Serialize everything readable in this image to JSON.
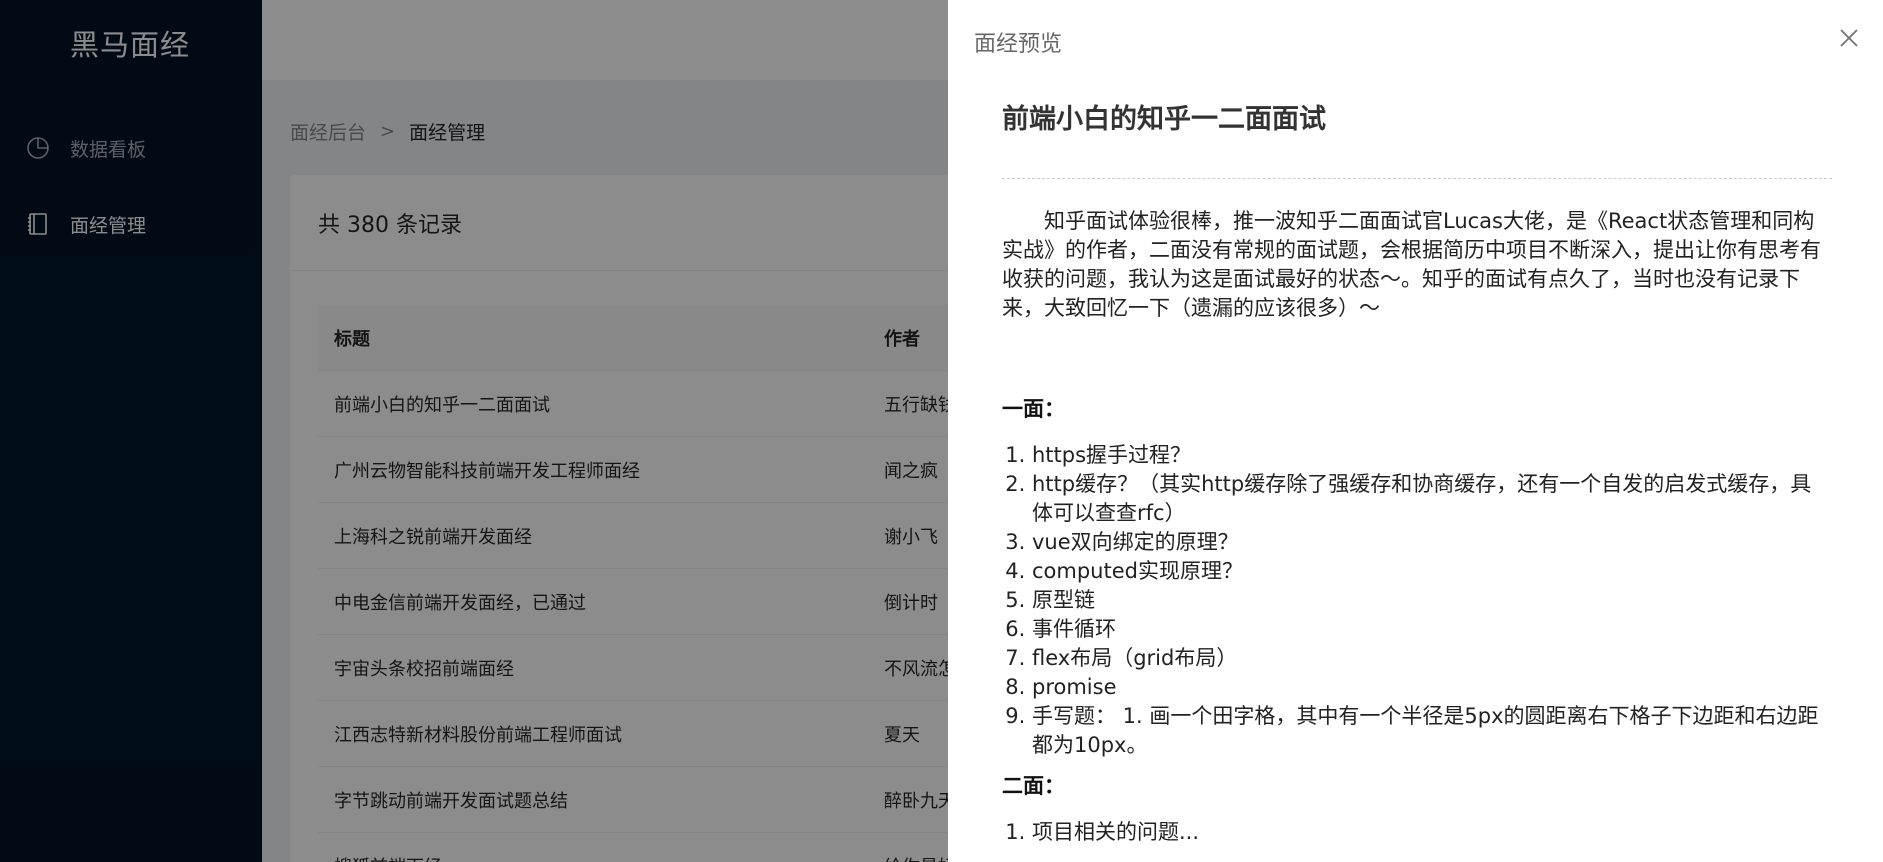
{
  "sidebar": {
    "logo": "黑马面经",
    "items": [
      {
        "label": "数据看板",
        "icon": "pie-chart-icon"
      },
      {
        "label": "面经管理",
        "icon": "book-icon"
      }
    ]
  },
  "breadcrumb": {
    "root": "面经后台",
    "separator": ">",
    "current": "面经管理"
  },
  "list": {
    "summary": "共 380 条记录",
    "columns": {
      "title": "标题",
      "author": "作者"
    },
    "rows": [
      {
        "title": "前端小白的知乎一二面面试",
        "author": "五行缺钱"
      },
      {
        "title": "广州云物智能科技前端开发工程师面经",
        "author": "闻之疯"
      },
      {
        "title": "上海科之锐前端开发面经",
        "author": "谢小飞"
      },
      {
        "title": "中电金信前端开发面经，已通过",
        "author": "倒计时"
      },
      {
        "title": "宇宙头条校招前端面经",
        "author": "不风流怎"
      },
      {
        "title": "江西志特新材料股份前端工程师面试",
        "author": "夏天"
      },
      {
        "title": "字节跳动前端开发面试题总结",
        "author": "醉卧九天"
      },
      {
        "title": "搜狐前端面经",
        "author": "给你最好"
      }
    ]
  },
  "drawer": {
    "title": "面经预览",
    "article": {
      "title": "前端小白的知乎一二面面试",
      "intro": "知乎面试体验很棒，推一波知乎二面面试官Lucas大佬，是《React状态管理和同构实战》的作者，二面没有常规的面试题，会根据简历中项目不断深入，提出让你有思考有收获的问题，我认为这是面试最好的状态～。知乎的面试有点久了，当时也没有记录下来，大致回忆一下（遗漏的应该很多）～",
      "section1": "一面：",
      "questions1": [
        "https握手过程？",
        "http缓存？（其实http缓存除了强缓存和协商缓存，还有一个自发的启发式缓存，具体可以查查rfc）",
        "vue双向绑定的原理？",
        "computed实现原理？",
        "原型链",
        "事件循环",
        "flex布局（grid布局）",
        "promise",
        "手写题： 1. 画一个田字格，其中有一个半径是5px的圆距离右下格子下边距和右边距都为10px。"
      ],
      "section2": "二面：",
      "questions2": [
        "项目相关的问题..."
      ]
    }
  },
  "colors": {
    "sidebar_bg": "#001529",
    "mask": "rgba(0,0,0,0.45)"
  }
}
